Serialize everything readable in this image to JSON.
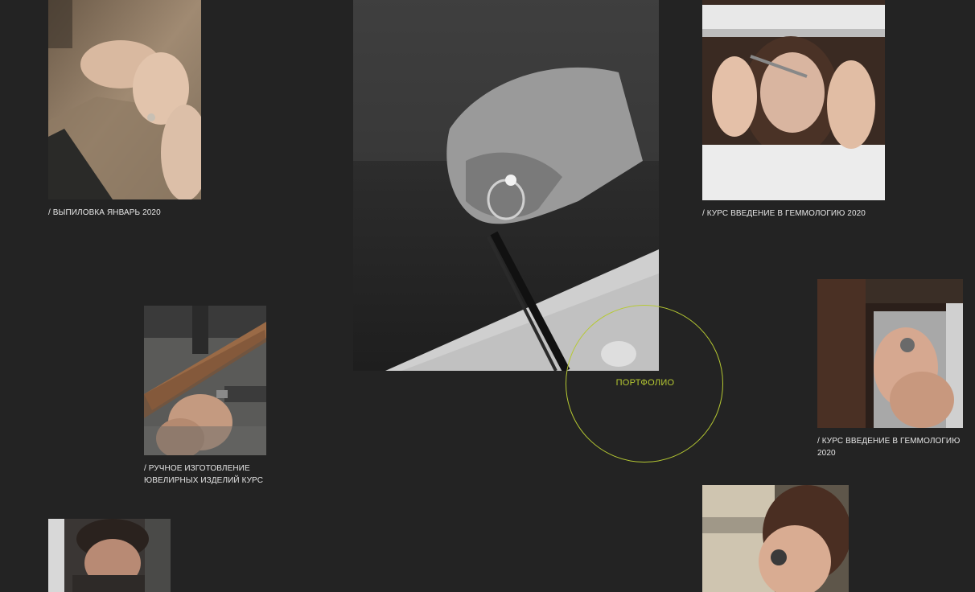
{
  "gallery": {
    "items": [
      {
        "id": "photo-polishing-jan-2020",
        "caption": "/ ВЫПИЛОВКА ЯНВАРЬ 2020"
      },
      {
        "id": "photo-ring-tweezers",
        "caption": ""
      },
      {
        "id": "photo-gemology-loupe-1",
        "caption": "/ КУРС ВВЕДЕНИЕ В ГЕММОЛОГИЮ 2020"
      },
      {
        "id": "photo-handmade-jewelry",
        "caption": "/ РУЧНОЕ ИЗГОТОВЛЕНИЕ ЮВЕЛИРНЫХ ИЗДЕЛИЙ КУРС"
      },
      {
        "id": "photo-gemology-loupe-2",
        "caption": "/ КУРС ВВЕДЕНИЕ В ГЕММОЛОГИЮ 2020"
      },
      {
        "id": "photo-student-workbench",
        "caption": ""
      },
      {
        "id": "photo-gemology-loupe-3",
        "caption": ""
      }
    ]
  },
  "portfolio": {
    "label": "ПОРТФОЛИО"
  },
  "colors": {
    "background": "#232323",
    "caption_text": "#e6e6e6",
    "accent": "#b6c932"
  }
}
